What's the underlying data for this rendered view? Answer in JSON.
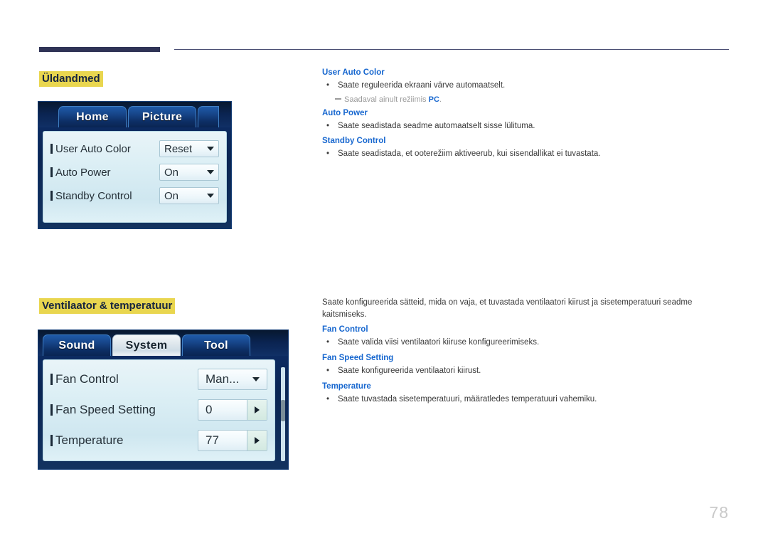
{
  "page": {
    "number": "78"
  },
  "sections": [
    {
      "heading": "Üldandmed",
      "osd": {
        "tabs": [
          {
            "label": "Home",
            "active": false
          },
          {
            "label": "Picture",
            "active": false
          },
          {
            "label": "",
            "active": false
          }
        ],
        "rows": [
          {
            "label": "User Auto Color",
            "value": "Reset",
            "control": "dropdown"
          },
          {
            "label": "Auto Power",
            "value": "On",
            "control": "dropdown"
          },
          {
            "label": "Standby Control",
            "value": "On",
            "control": "dropdown"
          }
        ]
      },
      "text": {
        "intro": "",
        "items": [
          {
            "title": "User Auto Color",
            "bullet": "Saate reguleerida ekraani värve automaatselt.",
            "note_prefix": "Saadaval ainult režiimis ",
            "note_bold": "PC",
            "note_suffix": "."
          },
          {
            "title": "Auto Power",
            "bullet": "Saate seadistada seadme automaatselt sisse lülituma."
          },
          {
            "title": "Standby Control",
            "bullet": "Saate seadistada, et ooterežiim aktiveerub, kui sisendallikat ei tuvastata."
          }
        ]
      }
    },
    {
      "heading": "Ventilaator & temperatuur",
      "osd": {
        "tabs": [
          {
            "label": "Sound",
            "active": false
          },
          {
            "label": "System",
            "active": true
          },
          {
            "label": "Tool",
            "active": false
          }
        ],
        "rows": [
          {
            "label": "Fan Control",
            "value": "Man...",
            "control": "dropdown"
          },
          {
            "label": "Fan Speed Setting",
            "value": "0",
            "control": "stepper"
          },
          {
            "label": "Temperature",
            "value": "77",
            "control": "stepper"
          }
        ]
      },
      "text": {
        "intro": "Saate konfigureerida sätteid, mida on vaja, et tuvastada ventilaatori kiirust ja sisetemperatuuri seadme kaitsmiseks.",
        "items": [
          {
            "title": "Fan Control",
            "bullet": "Saate valida viisi ventilaatori kiiruse konfigureerimiseks."
          },
          {
            "title": "Fan Speed Setting",
            "bullet": "Saate konfigureerida ventilaatori kiirust."
          },
          {
            "title": "Temperature",
            "bullet": "Saate tuvastada sisetemperatuuri, määratledes temperatuuri vahemiku."
          }
        ]
      }
    }
  ],
  "icons": {
    "caret_down": "chevron-down-icon",
    "caret_right": "chevron-right-icon"
  },
  "colors": {
    "highlight": "#e9d64f",
    "heading_blue": "#1767cf",
    "rule_navy": "#2f3356",
    "page_number": "#c9c9c9"
  }
}
